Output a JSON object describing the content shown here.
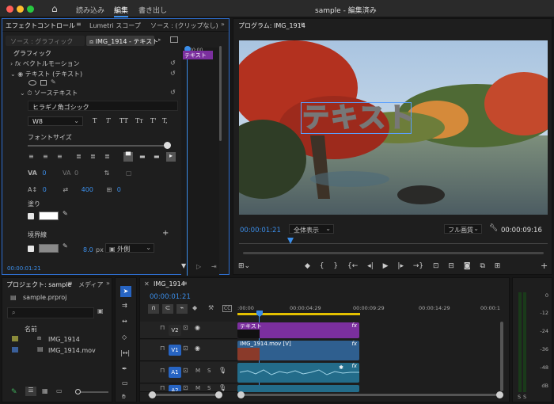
{
  "app": {
    "menu_tabs": [
      "読み込み",
      "編集",
      "書き出し"
    ],
    "active_tab": "編集",
    "window_title": "sample - 編集済み"
  },
  "effect_controls": {
    "tabs": [
      "エフェクトコントロール",
      "Lumetri スコープ",
      "ソース : (クリップなし)"
    ],
    "source_label": "ソース : グラフィック",
    "sequence_label": "IMG_1914 - テキスト",
    "timeline_time": ":00:00",
    "clip_label": "テキスト",
    "graphic_label": "グラフィック",
    "vector_motion": "ベクトルモーション",
    "text_layer": "テキスト (テキスト)",
    "source_text": "ソーステキスト",
    "font_name": "ヒラギノ角ゴシック",
    "font_weight": "W8",
    "style_buttons": [
      "T",
      "T",
      "TT",
      "Tт",
      "T'",
      "T,"
    ],
    "font_size_label": "フォントサイズ",
    "va_value": "0",
    "va2_value": "0",
    "baseline_value": "0",
    "tracking_value": "400",
    "tsume_value": "0",
    "fill_label": "塗り",
    "stroke_label": "境界線",
    "stroke_width": "8.0",
    "stroke_unit": "px",
    "stroke_pos": "外側",
    "timecode": "00:00:01:21"
  },
  "program": {
    "title": "プログラム: IMG_1914",
    "overlay_text": "テキスト",
    "timecode": "00:00:01:21",
    "fit": "全体表示",
    "quality": "フル画質",
    "duration": "00:00:09:16"
  },
  "project": {
    "tabs": [
      "プロジェクト: sample",
      "メディア"
    ],
    "file": "sample.prproj",
    "column_name": "名前",
    "items": [
      {
        "name": "IMG_1914",
        "color": "#8a8a3a"
      },
      {
        "name": "IMG_1914.mov",
        "color": "#3a5f9a"
      }
    ]
  },
  "timeline": {
    "tab": "IMG_1914",
    "timecode": "00:00:01:21",
    "ruler": [
      ":00:00",
      "00:00:04:29",
      "00:00:09:29",
      "00:00:14:29",
      "00:00:1"
    ],
    "tracks": [
      {
        "name": "V2",
        "label": "V2"
      },
      {
        "name": "V1",
        "label": "V1"
      },
      {
        "name": "A1",
        "label": "A1"
      },
      {
        "name": "A2",
        "label": "A2"
      }
    ],
    "clip_text": "テキスト",
    "clip_video": "IMG_1914.mov [V]",
    "fx": "fx"
  },
  "meter": {
    "labels": [
      "0",
      "-12",
      "-24",
      "-36",
      "-48",
      "dB"
    ],
    "solo": [
      "S",
      "S"
    ]
  },
  "colors": {
    "accent": "#3b8eea",
    "clip_purple": "#7b2f9e",
    "clip_blue": "#2f5f8f",
    "audio_teal": "#236c8a"
  }
}
